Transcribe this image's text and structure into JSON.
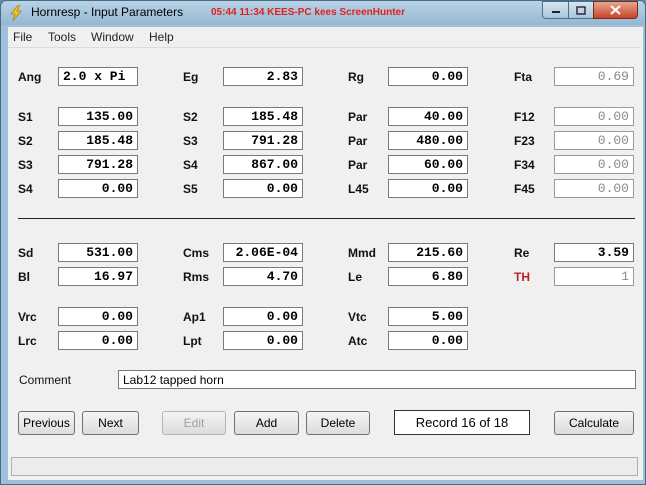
{
  "window": {
    "title": "Hornresp - Input Parameters",
    "overlay_text": "05:44  11:34  KEES-PC  kees  ScreenHunter",
    "icons": {
      "app": "lightning-icon",
      "minimize": "minimize-icon",
      "maximize": "maximize-icon",
      "close": "close-icon"
    }
  },
  "menu": [
    "File",
    "Tools",
    "Window",
    "Help"
  ],
  "params": {
    "ang": {
      "label": "Ang",
      "value": "2.0 x Pi"
    },
    "eg": {
      "label": "Eg",
      "value": "2.83"
    },
    "rg": {
      "label": "Rg",
      "value": "0.00"
    },
    "fta": {
      "label": "Fta",
      "value": "0.69"
    },
    "s1": {
      "label": "S1",
      "value": "135.00"
    },
    "s2_a": {
      "label": "S2",
      "value": "185.48"
    },
    "par1": {
      "label": "Par",
      "value": "40.00"
    },
    "f12": {
      "label": "F12",
      "value": "0.00"
    },
    "s2_b": {
      "label": "S2",
      "value": "185.48"
    },
    "s3_a": {
      "label": "S3",
      "value": "791.28"
    },
    "par2": {
      "label": "Par",
      "value": "480.00"
    },
    "f23": {
      "label": "F23",
      "value": "0.00"
    },
    "s3_b": {
      "label": "S3",
      "value": "791.28"
    },
    "s4_a": {
      "label": "S4",
      "value": "867.00"
    },
    "par3": {
      "label": "Par",
      "value": "60.00"
    },
    "f34": {
      "label": "F34",
      "value": "0.00"
    },
    "s4_b": {
      "label": "S4",
      "value": "0.00"
    },
    "s5": {
      "label": "S5",
      "value": "0.00"
    },
    "l45": {
      "label": "L45",
      "value": "0.00"
    },
    "f45": {
      "label": "F45",
      "value": "0.00"
    },
    "sd": {
      "label": "Sd",
      "value": "531.00"
    },
    "cms": {
      "label": "Cms",
      "value": "2.06E-04"
    },
    "mmd": {
      "label": "Mmd",
      "value": "215.60"
    },
    "re": {
      "label": "Re",
      "value": "3.59"
    },
    "bl": {
      "label": "Bl",
      "value": "16.97"
    },
    "rms": {
      "label": "Rms",
      "value": "4.70"
    },
    "le": {
      "label": "Le",
      "value": "6.80"
    },
    "th": {
      "label": "TH",
      "value": "1"
    },
    "vrc": {
      "label": "Vrc",
      "value": "0.00"
    },
    "ap1": {
      "label": "Ap1",
      "value": "0.00"
    },
    "vtc": {
      "label": "Vtc",
      "value": "5.00"
    },
    "lrc": {
      "label": "Lrc",
      "value": "0.00"
    },
    "lpt": {
      "label": "Lpt",
      "value": "0.00"
    },
    "atc": {
      "label": "Atc",
      "value": "0.00"
    }
  },
  "comment": {
    "label": "Comment",
    "value": "Lab12 tapped horn"
  },
  "buttons": {
    "previous": "Previous",
    "next": "Next",
    "edit": "Edit",
    "add": "Add",
    "delete": "Delete",
    "calculate": "Calculate"
  },
  "record": "Record 16 of 18",
  "colors": {
    "accent_label": "#c02020",
    "title_overlay": "#e02020"
  }
}
